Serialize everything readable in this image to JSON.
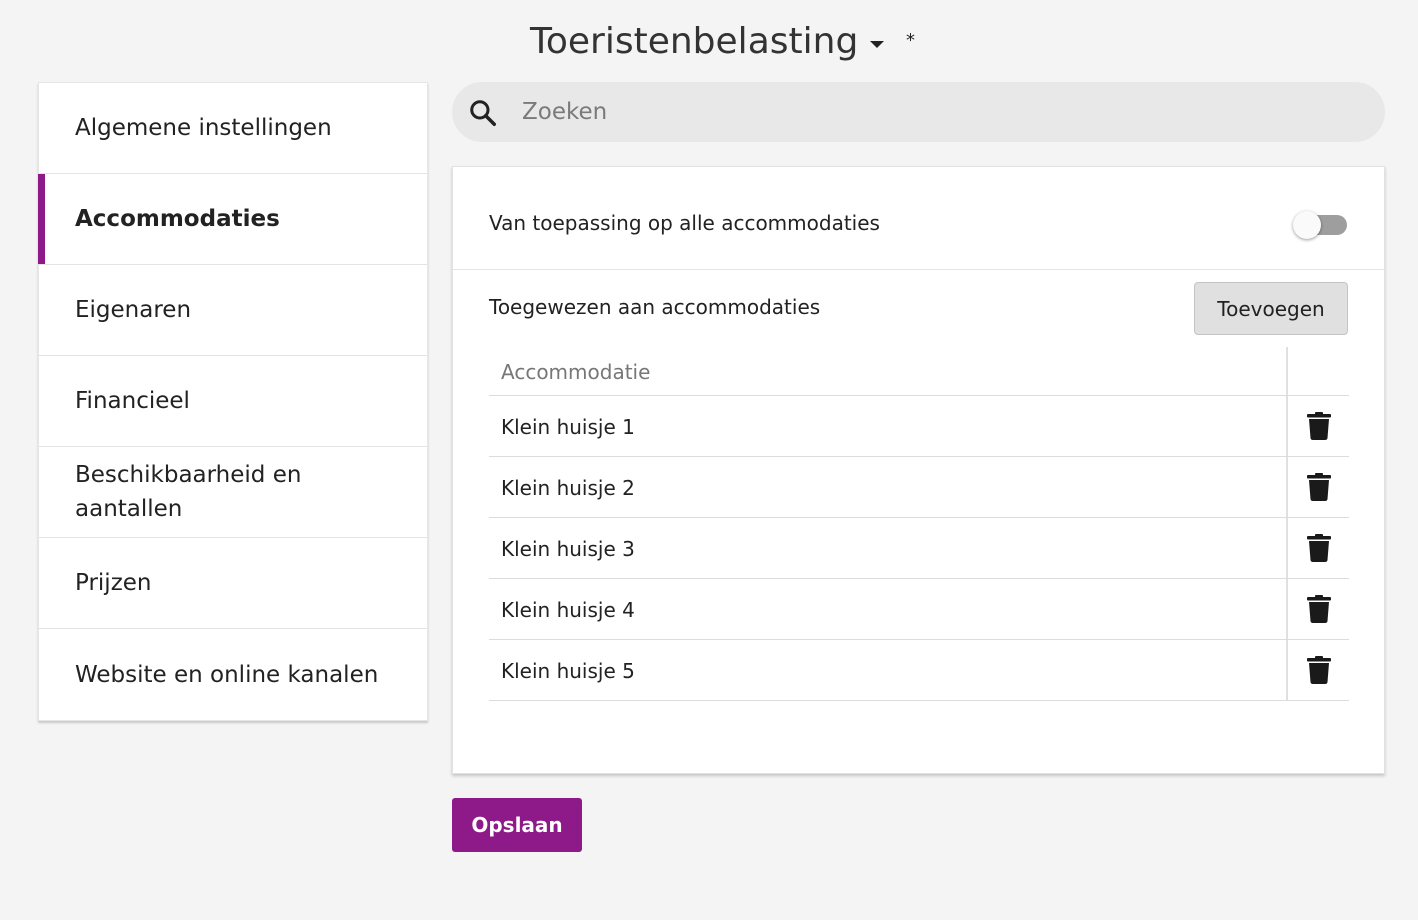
{
  "header": {
    "title": "Toeristenbelasting",
    "unsaved_marker": "*"
  },
  "sidebar": {
    "items": [
      {
        "label": "Algemene instellingen"
      },
      {
        "label": "Accommodaties"
      },
      {
        "label": "Eigenaren"
      },
      {
        "label": "Financieel"
      },
      {
        "label": "Beschikbaarheid en aantallen"
      },
      {
        "label": "Prijzen"
      },
      {
        "label": "Website en online kanalen"
      }
    ],
    "active": "Accommodaties"
  },
  "search": {
    "placeholder": "Zoeken",
    "value": ""
  },
  "card": {
    "apply_all_label": "Van toepassing op alle accommodaties",
    "apply_all_enabled": false,
    "assigned_label": "Toegewezen aan accommodaties",
    "add_button": "Toevoegen",
    "table": {
      "column_header": "Accommodatie",
      "rows": [
        {
          "name": "Klein huisje 1"
        },
        {
          "name": "Klein huisje 2"
        },
        {
          "name": "Klein huisje 3"
        },
        {
          "name": "Klein huisje 4"
        },
        {
          "name": "Klein huisje 5"
        }
      ]
    }
  },
  "actions": {
    "save_label": "Opslaan"
  },
  "colors": {
    "accent": "#8e1a8a",
    "background": "#f4f4f4"
  },
  "icons": {
    "search": "search-icon",
    "delete": "trash-icon",
    "dropdown": "caret-down-icon"
  }
}
